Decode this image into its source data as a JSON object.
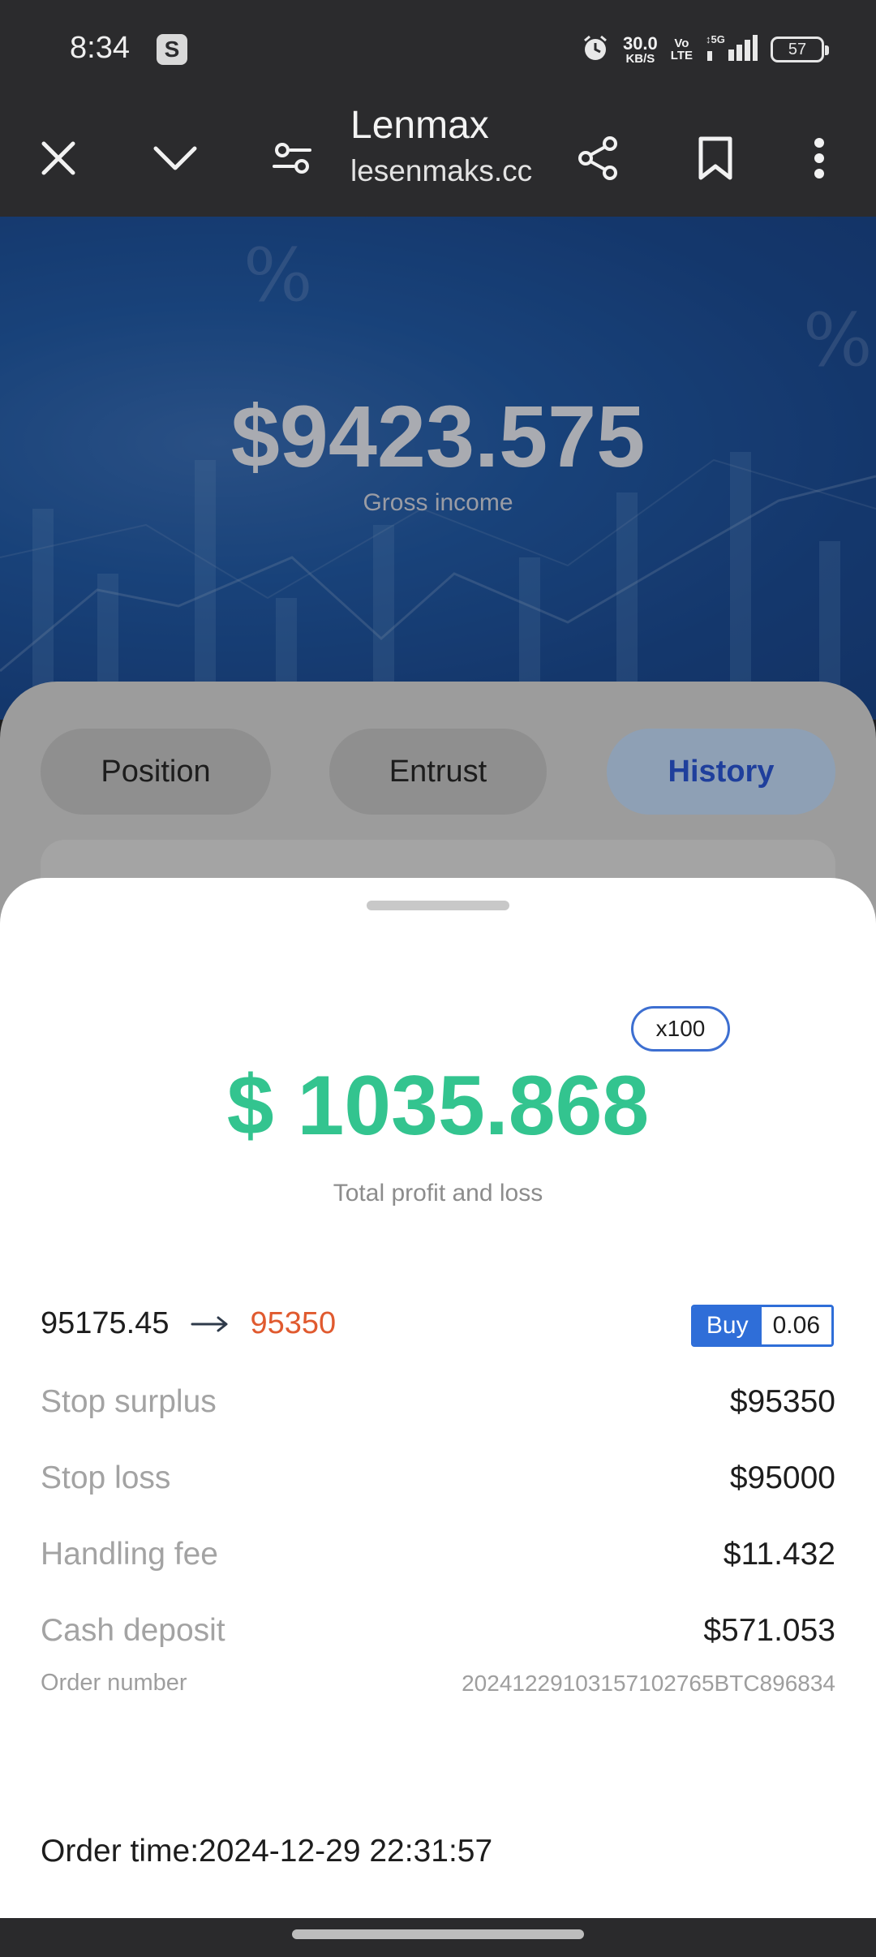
{
  "status_bar": {
    "time": "8:34",
    "app_badge": "S",
    "net_speed_value": "30.0",
    "net_speed_unit": "KB/S",
    "volte_top": "Vo",
    "volte_bottom": "LTE",
    "network": "5G",
    "battery": "57",
    "icons": [
      "alarm-icon",
      "signal-icon",
      "battery-icon"
    ]
  },
  "browser": {
    "title": "Lenmax",
    "url": "lesenmaks.cc",
    "icons": [
      "close-icon",
      "chevron-down-icon",
      "site-settings-icon",
      "share-icon",
      "bookmark-icon",
      "more-vert-icon"
    ]
  },
  "page": {
    "gross_income": "$9423.575",
    "gross_income_label": "Gross income",
    "tabs": [
      {
        "label": "Position",
        "active": false
      },
      {
        "label": "Entrust",
        "active": false
      },
      {
        "label": "History",
        "active": true
      }
    ]
  },
  "sheet": {
    "leverage": "x100",
    "total_pnl": "$ 1035.868",
    "total_pnl_label": "Total profit and loss",
    "open_price": "95175.45",
    "close_price": "95350",
    "side": "Buy",
    "quantity": "0.06",
    "details": [
      {
        "label": "Stop surplus",
        "value": "$95350"
      },
      {
        "label": "Stop loss",
        "value": "$95000"
      },
      {
        "label": "Handling fee",
        "value": "$11.432"
      },
      {
        "label": "Cash deposit",
        "value": "$571.053"
      }
    ],
    "order_number_label": "Order number",
    "order_number": "20241229103157102765BTC896834",
    "order_time": "Order time:2024-12-29 22:31:57"
  },
  "colors": {
    "profit_green": "#33c48f",
    "close_price_orange": "#e05a2f",
    "buy_blue": "#2f6ed8",
    "hero_blue": "#2563b6"
  }
}
